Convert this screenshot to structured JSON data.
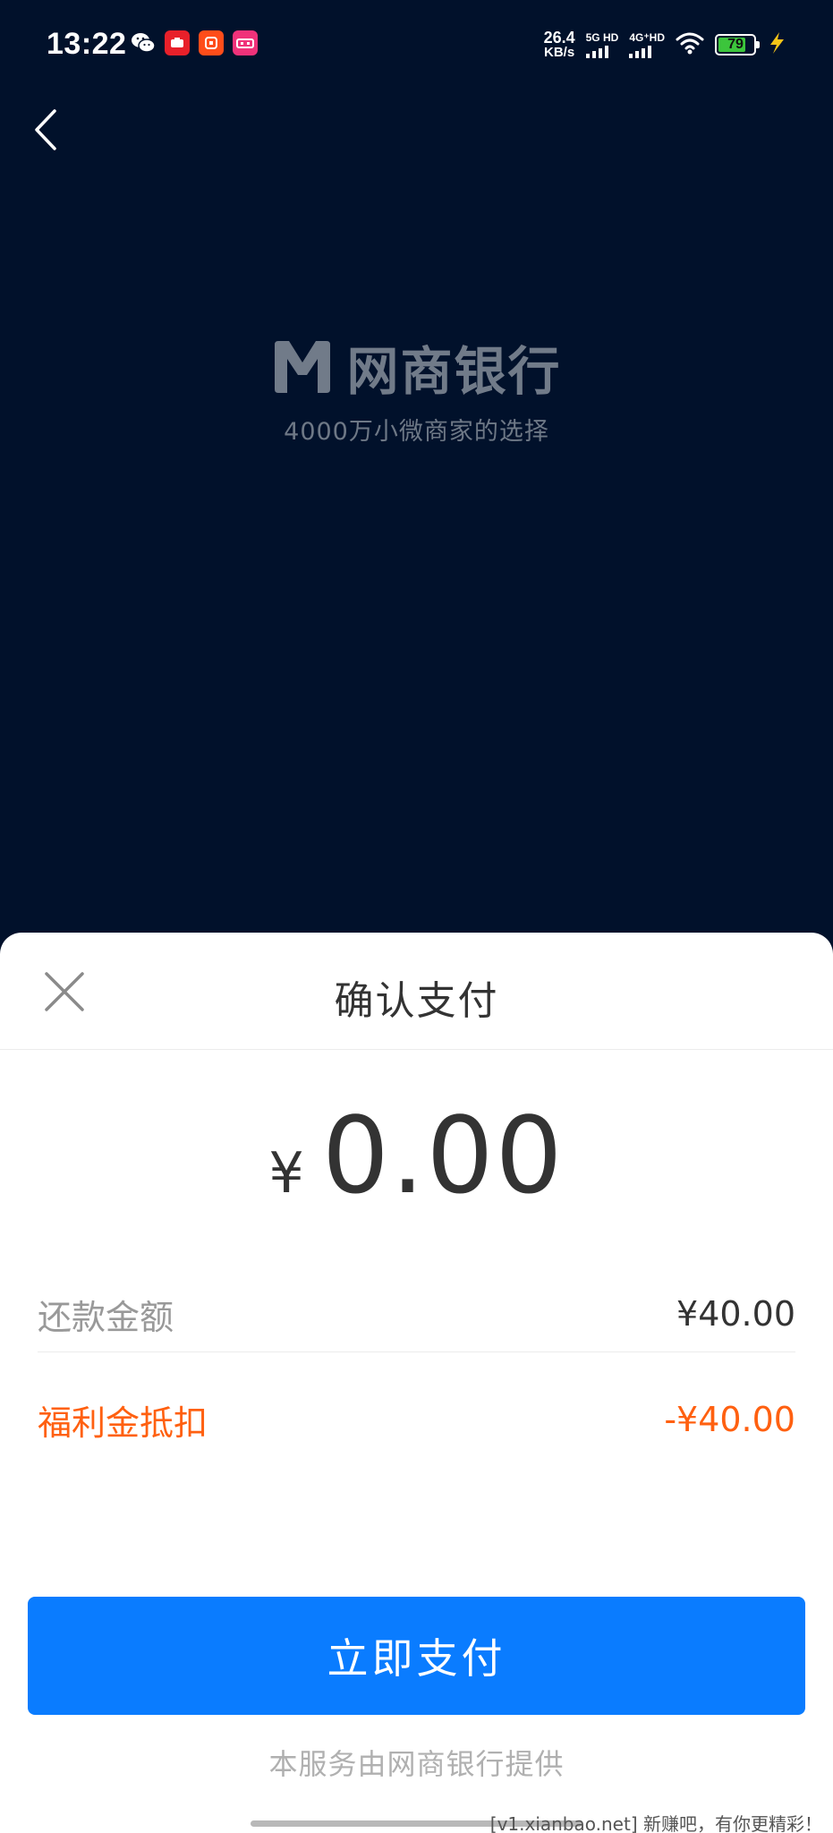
{
  "status_bar": {
    "time": "13:22",
    "net_speed_value": "26.4",
    "net_speed_unit": "KB/s",
    "signal1_label": "5G HD",
    "signal2_label": "4G⁺HD",
    "battery_level": "79",
    "battery_fraction": 0.79,
    "notification_icons": [
      "wechat-icon",
      "app-red-icon",
      "app-orange-icon",
      "app-pink-icon"
    ]
  },
  "nav": {
    "back_icon": "chevron-left-icon"
  },
  "brand": {
    "name": "网商银行",
    "slogan": "4000万小微商家的选择",
    "logo_icon": "mybank-m-logo-icon"
  },
  "sheet": {
    "title": "确认支付",
    "close_icon": "close-icon",
    "amount_symbol": "¥",
    "amount_value": "0.00",
    "repay_label": "还款金额",
    "repay_value": "¥40.00",
    "welfare_label": "福利金抵扣",
    "welfare_value": "-¥40.00",
    "pay_button_label": "立即支付",
    "provider_note": "本服务由网商银行提供"
  },
  "watermark": "[v1.xianbao.net] 新赚吧，有你更精彩！",
  "colors": {
    "background": "#01112b",
    "primary_button": "#0a7cff",
    "welfare_accent": "#ff6010",
    "battery": "#3cc53c"
  }
}
